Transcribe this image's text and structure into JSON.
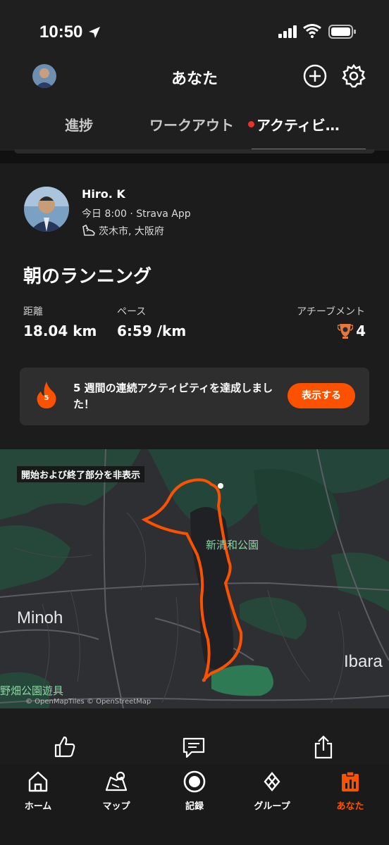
{
  "status_bar": {
    "time": "10:50"
  },
  "header": {
    "title": "あなた"
  },
  "tabs": [
    {
      "label": "進捗"
    },
    {
      "label": "ワークアウト"
    },
    {
      "label": "アクティビ…"
    }
  ],
  "activity": {
    "athlete_name": "Hiro. K",
    "meta": "今日 8:00 · Strava App",
    "location": "茨木市, 大阪府",
    "title": "朝のランニング",
    "stats": {
      "distance_label": "距離",
      "distance_value": "18.04 km",
      "pace_label": "ペース",
      "pace_value": "6:59 /km",
      "achievements_label": "アチーブメント",
      "achievements_value": "4"
    },
    "streak": {
      "weeks": "5",
      "text": "5 週間の連続アクティビティを達成しました！",
      "button_label": "表示する"
    }
  },
  "map": {
    "note": "開始および終了部分を非表示",
    "labels": {
      "minoh": "Minoh",
      "ibara": "Ibara",
      "park": "新清和公園",
      "park2": "野畑公園遊具"
    },
    "attribution": "© OpenMapTiles © OpenStreetMap"
  },
  "bottom_nav": [
    {
      "label": "ホーム"
    },
    {
      "label": "マップ"
    },
    {
      "label": "記録"
    },
    {
      "label": "グループ"
    },
    {
      "label": "あなた"
    }
  ],
  "colors": {
    "accent": "#fc5200",
    "background": "#111111",
    "card": "#1c1c1c"
  }
}
